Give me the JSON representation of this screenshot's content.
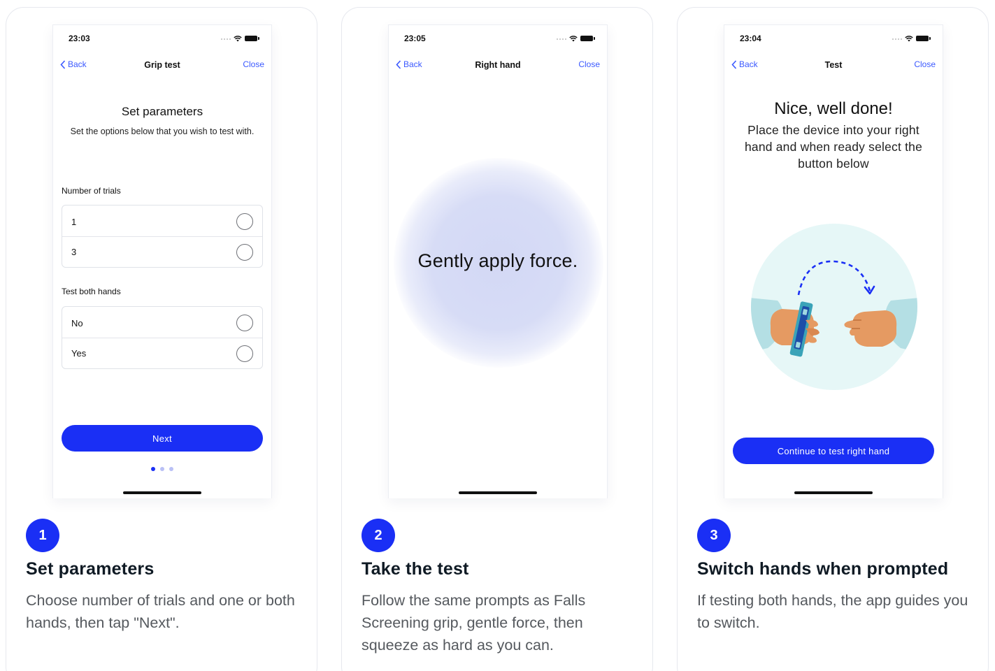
{
  "colors": {
    "accent": "#1a2ff5",
    "link": "#3b59ff",
    "glow": "#d3d8f5",
    "illustration_bg": "#e6f7f7"
  },
  "icons": {
    "back": "chevron-left-icon",
    "wifi": "wifi-icon",
    "battery": "battery-icon"
  },
  "steps": [
    {
      "badge": "1",
      "title": "Set parameters",
      "description": "Choose number of trials and one or both hands, then tap \"Next\".",
      "phone": {
        "time": "23:03",
        "nav": {
          "back": "Back",
          "title": "Grip test",
          "close": "Close"
        },
        "heading": "Set parameters",
        "subheading": "Set the options below that you wish to test with.",
        "groups": [
          {
            "label": "Number of trials",
            "options": [
              "1",
              "3"
            ]
          },
          {
            "label": "Test both hands",
            "options": [
              "No",
              "Yes"
            ]
          }
        ],
        "button": "Next",
        "pager": {
          "count": 3,
          "active": 1
        }
      }
    },
    {
      "badge": "2",
      "title": "Take the test",
      "description": "Follow the same prompts as Falls Screening grip, gentle force, then squeeze as hard as you can.",
      "phone": {
        "time": "23:05",
        "nav": {
          "back": "Back",
          "title": "Right hand",
          "close": "Close"
        },
        "prompt": "Gently apply force."
      }
    },
    {
      "badge": "3",
      "title": "Switch hands when prompted",
      "description": "If testing both hands, the app guides you to switch.",
      "phone": {
        "time": "23:04",
        "nav": {
          "back": "Back",
          "title": "Test",
          "close": "Close"
        },
        "heading": "Nice, well done!",
        "subheading": "Place the device into your right hand and when ready select the button below",
        "button": "Continue to test right hand"
      }
    }
  ]
}
